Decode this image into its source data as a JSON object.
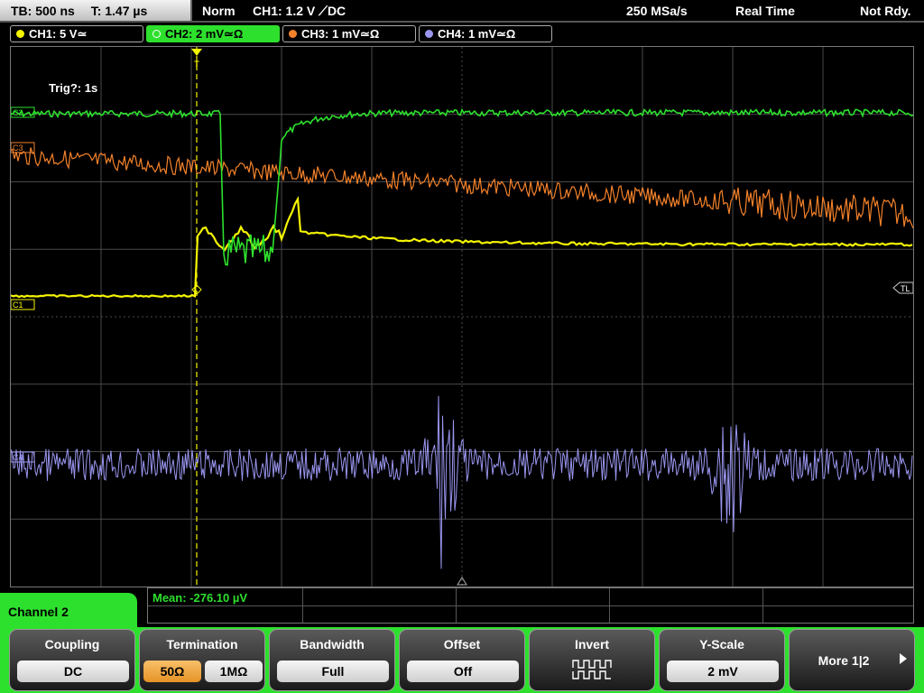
{
  "status_bar": {
    "timebase": "TB: 500 ns",
    "trigger_time": "T: 1.47 µs",
    "trigger_mode": "Norm",
    "trigger_source": "CH1: 1.2 V ⟋DC",
    "sample_rate": "250 MSa/s",
    "acq_mode": "Real Time",
    "status": "Not Rdy."
  },
  "channels": [
    {
      "id": "ch1",
      "label": "CH1: 5 V≃",
      "color": "#f5f500",
      "active": false
    },
    {
      "id": "ch2",
      "label": "CH2: 2 mV≃Ω",
      "color": "#2de02d",
      "active": true
    },
    {
      "id": "ch3",
      "label": "CH3: 1 mV≃Ω",
      "color": "#f5822a",
      "active": false
    },
    {
      "id": "ch4",
      "label": "CH4: 1 mV≃Ω",
      "color": "#9a96f0",
      "active": false
    }
  ],
  "display": {
    "trigger_info": "Trig?: 1s",
    "channel_markers": {
      "c1": "C1",
      "c2": "C2",
      "c3": "C3",
      "c4": "C4",
      "trigger_level": "TL",
      "trigger_pos": "T"
    }
  },
  "measurement": {
    "text": "Mean: -276.10 µV"
  },
  "menu": {
    "title": "Channel 2",
    "softkeys": {
      "coupling": {
        "label": "Coupling",
        "value": "DC"
      },
      "termination": {
        "label": "Termination",
        "options": [
          "50Ω",
          "1MΩ"
        ],
        "selected": "50Ω"
      },
      "bandwidth": {
        "label": "Bandwidth",
        "value": "Full"
      },
      "offset": {
        "label": "Offset",
        "value": "Off"
      },
      "invert": {
        "label": "Invert",
        "icon": "invert-waveform-icon"
      },
      "yscale": {
        "label": "Y-Scale",
        "value": "2 mV"
      },
      "more": {
        "label": "More 1|2"
      }
    }
  },
  "colors": {
    "accent": "#2de02d",
    "ch1": "#f5f500",
    "ch2": "#2de02d",
    "ch3": "#f5822a",
    "ch4": "#9a96f0",
    "selected_option": "#e69325"
  }
}
